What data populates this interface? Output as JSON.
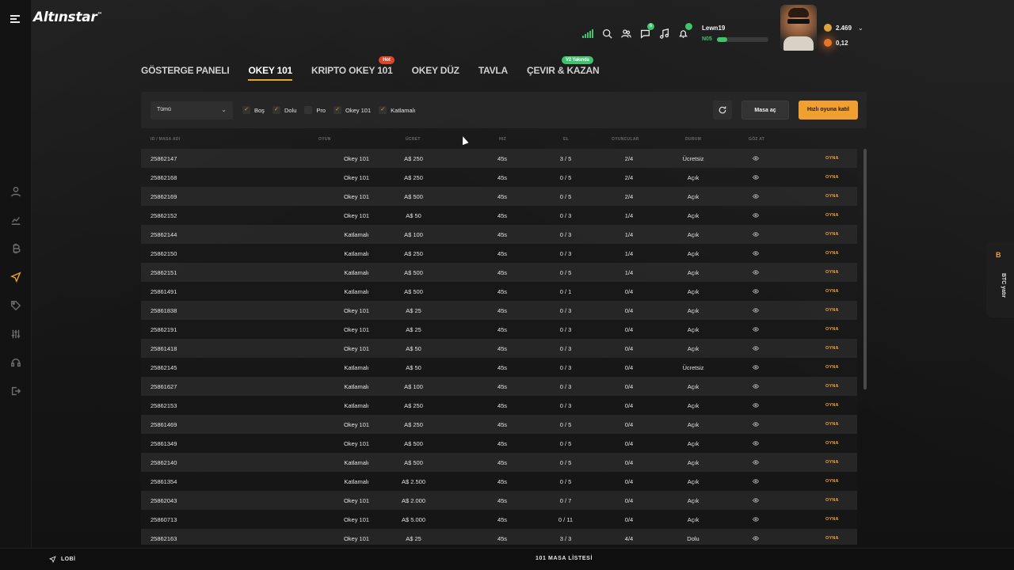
{
  "app": {
    "logo": "Altınstar",
    "logo_mark": "™"
  },
  "user": {
    "name": "Lewn19",
    "level": "N05",
    "xp_fraction": 0.2
  },
  "wallet": {
    "gold_balance": "2.469",
    "btc_balance": "0,12"
  },
  "tabs": [
    {
      "label": "GÖSTERGE PANELI",
      "active": false,
      "badge": ""
    },
    {
      "label": "OKEY 101",
      "active": true,
      "badge": ""
    },
    {
      "label": "KRIPTO OKEY 101",
      "active": false,
      "badge": "Hot"
    },
    {
      "label": "OKEY DÜZ",
      "active": false,
      "badge": ""
    },
    {
      "label": "TAVLA",
      "active": false,
      "badge": ""
    },
    {
      "label": "ÇEVIR & KAZAN",
      "active": false,
      "badge": "V2 Yakında"
    }
  ],
  "filters": {
    "select_value": "Tümü",
    "checks": [
      {
        "label": "Boş",
        "checked": true
      },
      {
        "label": "Dolu",
        "checked": true
      },
      {
        "label": "Pro",
        "checked": false
      },
      {
        "label": "Okey 101",
        "checked": true
      },
      {
        "label": "Katlamalı",
        "checked": true
      }
    ],
    "create_table": "Masa aç",
    "quick_join": "Hızlı oyuna katıl"
  },
  "table": {
    "headers": [
      "ID / MASA ADI",
      "OYUN",
      "ÜCRET",
      "HIZ",
      "EL",
      "OYUNCULAR",
      "DURUM",
      "GÖZ AT"
    ],
    "play_label": "OYNA",
    "rows": [
      [
        "25862147",
        "Okey 101",
        "A$ 250",
        "45s",
        "3 / 5",
        "2/4",
        "Ücretsiz"
      ],
      [
        "25862168",
        "Okey 101",
        "A$ 250",
        "45s",
        "0 / 5",
        "2/4",
        "Açık"
      ],
      [
        "25862169",
        "Okey 101",
        "A$ 500",
        "45s",
        "0 / 5",
        "2/4",
        "Açık"
      ],
      [
        "25862152",
        "Okey 101",
        "A$ 50",
        "45s",
        "0 / 3",
        "1/4",
        "Açık"
      ],
      [
        "25862144",
        "Katlamalı",
        "A$ 100",
        "45s",
        "0 / 3",
        "1/4",
        "Açık"
      ],
      [
        "25862150",
        "Katlamalı",
        "A$ 250",
        "45s",
        "0 / 3",
        "1/4",
        "Açık"
      ],
      [
        "25862151",
        "Katlamalı",
        "A$ 500",
        "45s",
        "0 / 5",
        "1/4",
        "Açık"
      ],
      [
        "25861491",
        "Katlamalı",
        "A$ 500",
        "45s",
        "0 / 1",
        "0/4",
        "Açık"
      ],
      [
        "25861838",
        "Okey 101",
        "A$ 25",
        "45s",
        "0 / 3",
        "0/4",
        "Açık"
      ],
      [
        "25862191",
        "Okey 101",
        "A$ 25",
        "45s",
        "0 / 3",
        "0/4",
        "Açık"
      ],
      [
        "25861418",
        "Okey 101",
        "A$ 50",
        "45s",
        "0 / 3",
        "0/4",
        "Açık"
      ],
      [
        "25862145",
        "Katlamalı",
        "A$ 50",
        "45s",
        "0 / 3",
        "0/4",
        "Ücretsiz"
      ],
      [
        "25861627",
        "Katlamalı",
        "A$ 100",
        "45s",
        "0 / 3",
        "0/4",
        "Açık"
      ],
      [
        "25862153",
        "Katlamalı",
        "A$ 250",
        "45s",
        "0 / 3",
        "0/4",
        "Açık"
      ],
      [
        "25861469",
        "Okey 101",
        "A$ 250",
        "45s",
        "0 / 5",
        "0/4",
        "Açık"
      ],
      [
        "25861349",
        "Okey 101",
        "A$ 500",
        "45s",
        "0 / 5",
        "0/4",
        "Açık"
      ],
      [
        "25862140",
        "Katlamalı",
        "A$ 500",
        "45s",
        "0 / 5",
        "0/4",
        "Açık"
      ],
      [
        "25861354",
        "Katlamalı",
        "A$ 2.500",
        "45s",
        "0 / 5",
        "0/4",
        "Açık"
      ],
      [
        "25862043",
        "Okey 101",
        "A$ 2.000",
        "45s",
        "0 / 7",
        "0/4",
        "Açık"
      ],
      [
        "25860713",
        "Okey 101",
        "A$ 5.000",
        "45s",
        "0 / 11",
        "0/4",
        "Açık"
      ],
      [
        "25862163",
        "Okey 101",
        "A$ 25",
        "45s",
        "3 / 3",
        "4/4",
        "Dolu"
      ]
    ]
  },
  "side_tab": {
    "symbol": "B",
    "label": "BTC yatır"
  },
  "footer": {
    "lobby": "LOBİ",
    "title": "101 MASA LİSTESİ"
  },
  "colors": {
    "accent": "#f0a030",
    "green": "#3ec46d",
    "hot": "#e0452c"
  }
}
